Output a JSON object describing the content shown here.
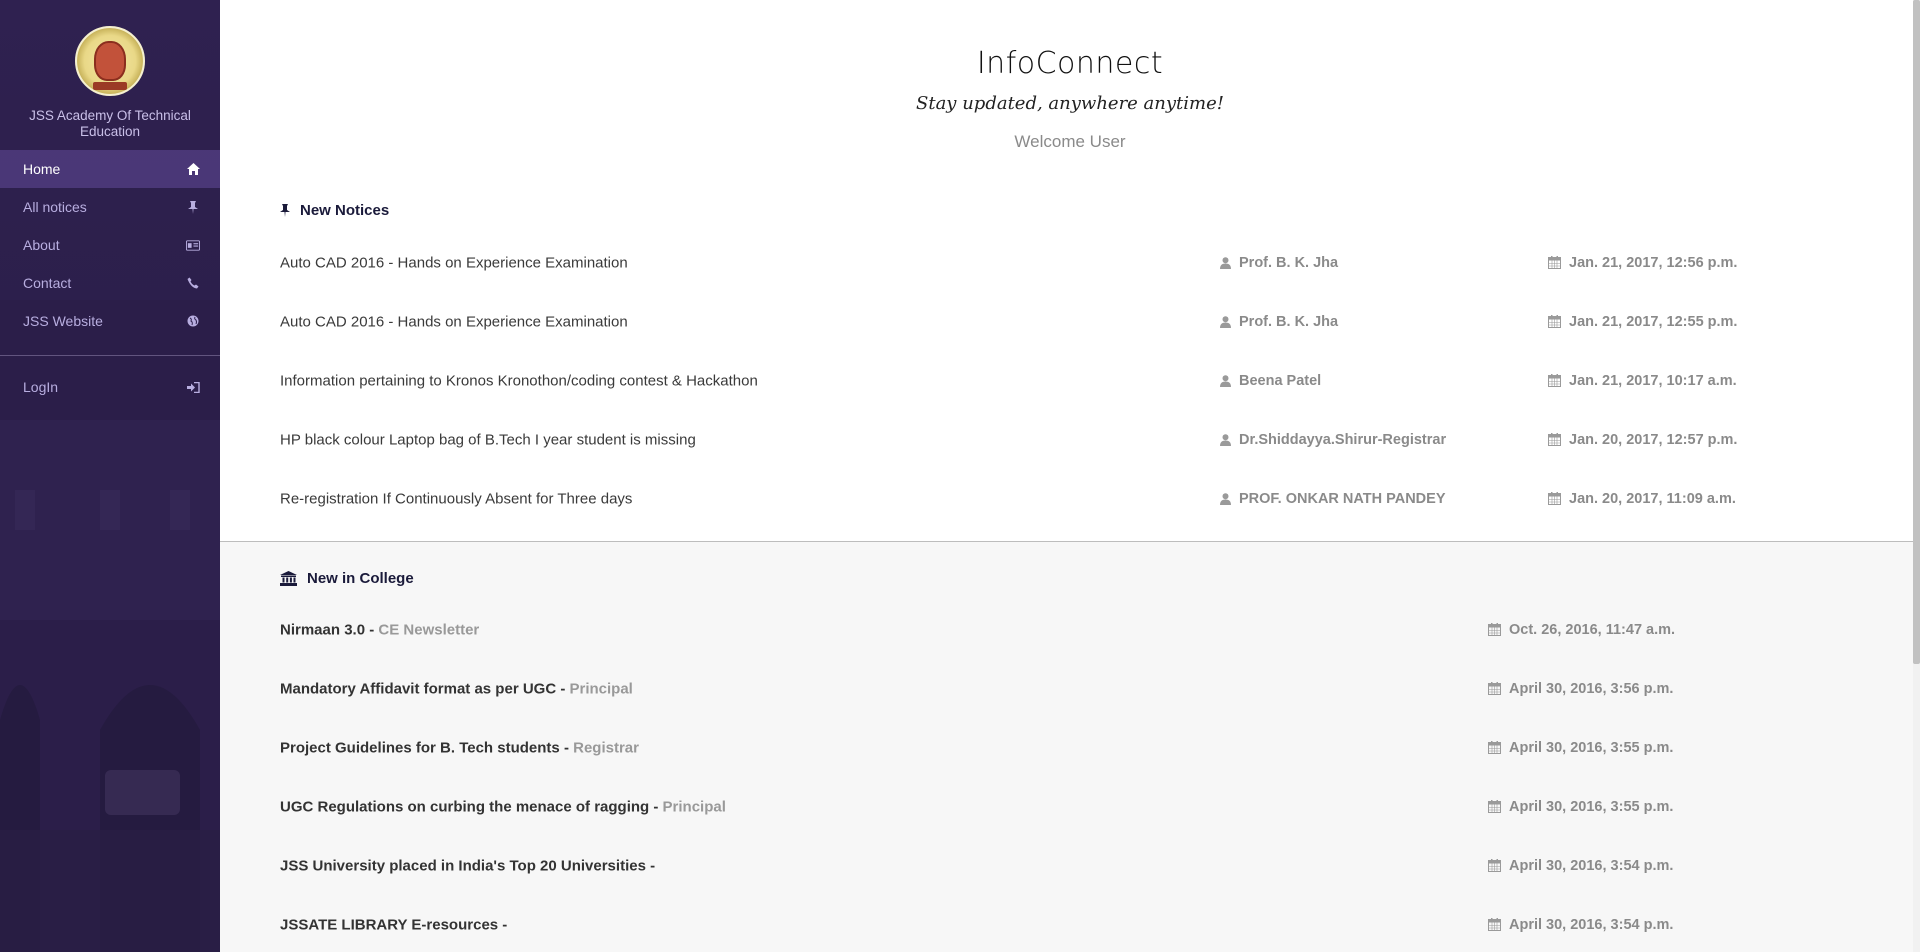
{
  "sidebar": {
    "brand_name": "JSS Academy Of Technical Education",
    "logo_alt": "NOIDA",
    "items": [
      {
        "label": "Home",
        "icon": "home-icon",
        "active": true
      },
      {
        "label": "All notices",
        "icon": "pin-icon",
        "active": false
      },
      {
        "label": "About",
        "icon": "id-card-icon",
        "active": false
      },
      {
        "label": "Contact",
        "icon": "phone-icon",
        "active": false
      },
      {
        "label": "JSS Website",
        "icon": "globe-icon",
        "active": false
      }
    ],
    "login": {
      "label": "LogIn",
      "icon": "sign-in-icon"
    }
  },
  "header": {
    "title": "InfoConnect",
    "tagline": "Stay updated, anywhere anytime!",
    "welcome": "Welcome User"
  },
  "new_notices": {
    "heading": "New Notices",
    "items": [
      {
        "title": "Auto CAD 2016 - Hands on Experience Examination",
        "author": "Prof. B. K. Jha",
        "date": "Jan. 21, 2017, 12:56 p.m."
      },
      {
        "title": "Auto CAD 2016 - Hands on Experience Examination",
        "author": "Prof. B. K. Jha",
        "date": "Jan. 21, 2017, 12:55 p.m."
      },
      {
        "title": "Information pertaining to Kronos Kronothon/coding contest & Hackathon",
        "author": "Beena Patel",
        "date": "Jan. 21, 2017, 10:17 a.m."
      },
      {
        "title": "HP black colour Laptop bag of B.Tech I year student is missing",
        "author": "Dr.Shiddayya.Shirur-Registrar",
        "date": "Jan. 20, 2017, 12:57 p.m."
      },
      {
        "title": "Re-registration If Continuously Absent for Three days",
        "author": "PROF. ONKAR NATH PANDEY",
        "date": "Jan. 20, 2017, 11:09 a.m."
      }
    ]
  },
  "new_in_college": {
    "heading": "New in College",
    "items": [
      {
        "title": "Nirmaan 3.0",
        "author": "CE Newsletter",
        "date": "Oct. 26, 2016, 11:47 a.m."
      },
      {
        "title": "Mandatory Affidavit format as per UGC",
        "author": "Principal",
        "date": "April 30, 2016, 3:56 p.m."
      },
      {
        "title": "Project Guidelines for B. Tech students",
        "author": "Registrar",
        "date": "April 30, 2016, 3:55 p.m."
      },
      {
        "title": "UGC Regulations on curbing the menace of ragging",
        "author": "Principal",
        "date": "April 30, 2016, 3:55 p.m."
      },
      {
        "title": "JSS University placed in India's Top 20 Universities",
        "author": "",
        "date": "April 30, 2016, 3:54 p.m."
      },
      {
        "title": "JSSATE LIBRARY E-resources",
        "author": "",
        "date": "April 30, 2016, 3:54 p.m."
      }
    ]
  }
}
